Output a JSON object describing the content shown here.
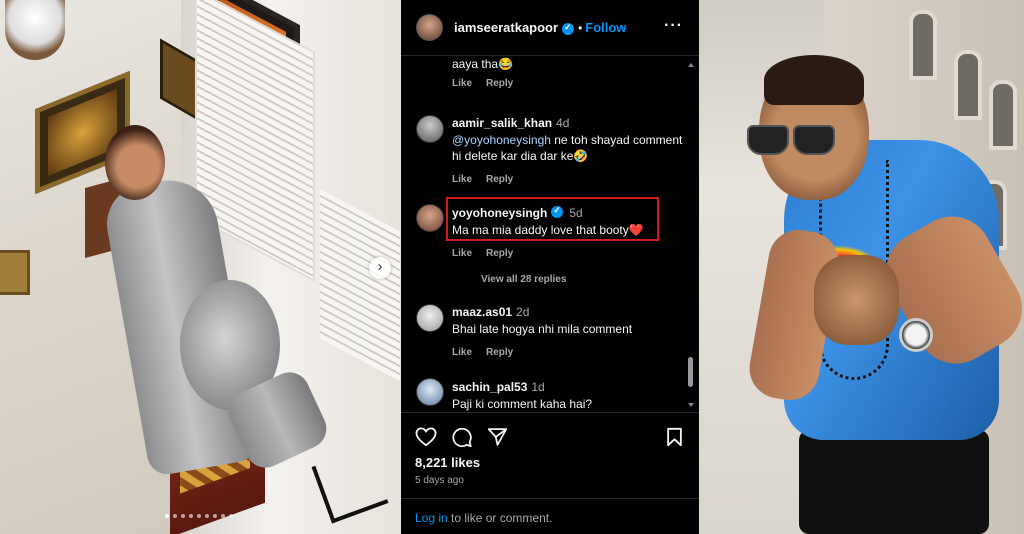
{
  "post": {
    "username": "iamseeratkapoor",
    "separator": "•",
    "follow_label": "Follow",
    "more_label": "···"
  },
  "comments": [
    {
      "text": "aaya tha😂",
      "like": "Like",
      "reply": "Reply"
    },
    {
      "username": "aamir_salik_khan",
      "time": "4d",
      "mention": "@yoyohoneysingh",
      "text": " ne toh shayad comment hi delete kar dia dar ke🤣",
      "like": "Like",
      "reply": "Reply"
    },
    {
      "username": "yoyohoneysingh",
      "time": "5d",
      "text": "Ma ma mia daddy love that booty❤️",
      "like": "Like",
      "reply": "Reply",
      "verified": true
    },
    {
      "view_replies": "View all 28 replies"
    },
    {
      "username": "maaz.as01",
      "time": "2d",
      "text": "Bhai late hogya nhi mila comment",
      "like": "Like",
      "reply": "Reply"
    },
    {
      "username": "sachin_pal53",
      "time": "1d",
      "text": "Paji ki comment kaha hai?"
    }
  ],
  "footer": {
    "likes": "8,221 likes",
    "ago": "5 days ago",
    "login_link": "Log in",
    "login_rest": " to like or comment."
  },
  "carousel": {
    "next_icon": "›",
    "dot_count": 9
  },
  "colors": {
    "background": "#000000",
    "link_blue": "#0095f6",
    "highlight_red": "#d21a1a",
    "muted": "#a8a8a8"
  },
  "icons": [
    "heart-icon",
    "comment-icon",
    "share-icon",
    "bookmark-icon",
    "more-icon",
    "verified-icon"
  ]
}
